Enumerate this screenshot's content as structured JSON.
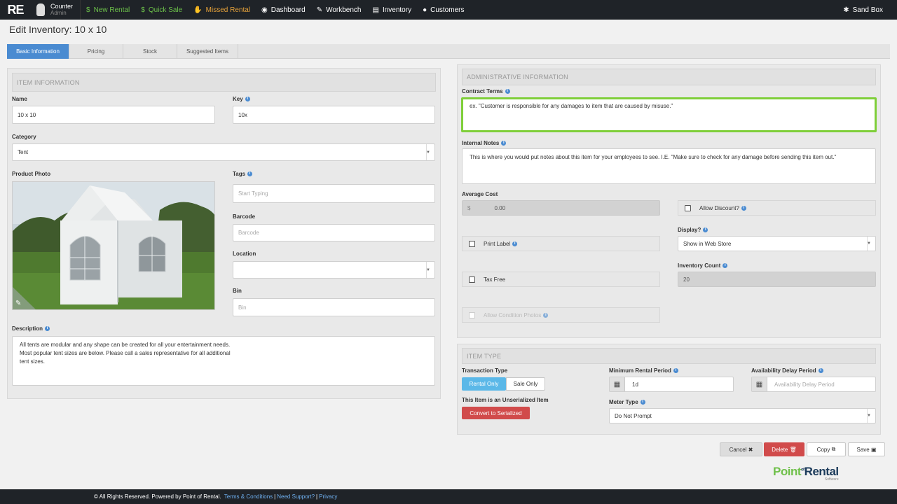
{
  "app": {
    "logo": "RE",
    "user_name": "Counter",
    "user_role": "Admin"
  },
  "nav": [
    {
      "label": "New Rental",
      "icon": "$",
      "icon_name": "dollar-icon",
      "color": "#6cc04a"
    },
    {
      "label": "Quick Sale",
      "icon": "$",
      "icon_name": "dollar-icon",
      "color": "#6cc04a"
    },
    {
      "label": "Missed Rental",
      "icon": "✋",
      "icon_name": "hand-icon",
      "color": "#e8a33a"
    },
    {
      "label": "Dashboard",
      "icon": "◉",
      "icon_name": "dashboard-icon",
      "color": "#ffffff"
    },
    {
      "label": "Workbench",
      "icon": "✎",
      "icon_name": "wrench-icon",
      "color": "#ffffff"
    },
    {
      "label": "Inventory",
      "icon": "▤",
      "icon_name": "inventory-icon",
      "color": "#ffffff"
    },
    {
      "label": "Customers",
      "icon": "●",
      "icon_name": "user-icon",
      "color": "#ffffff"
    }
  ],
  "sandbox": {
    "label": "Sand Box",
    "icon_name": "gear-icon"
  },
  "page_title": "Edit Inventory: 10 x 10",
  "tabs": [
    "Basic Information",
    "Pricing",
    "Stock",
    "Suggested Items"
  ],
  "item_info": {
    "heading": "ITEM INFORMATION",
    "name_label": "Name",
    "name_value": "10 x 10",
    "key_label": "Key",
    "key_value": "10x",
    "category_label": "Category",
    "category_value": "Tent",
    "photo_label": "Product Photo",
    "tags_label": "Tags",
    "tags_placeholder": "Start Typing",
    "barcode_label": "Barcode",
    "barcode_placeholder": "Barcode",
    "location_label": "Location",
    "location_value": "",
    "bin_label": "Bin",
    "bin_placeholder": "Bin",
    "description_label": "Description",
    "description_value": "All tents are modular and any shape can be created for all your entertainment needs.\nMost popular tent sizes are below. Please call a sales representative for all additional\ntent sizes."
  },
  "admin_info": {
    "heading": "ADMINISTRATIVE INFORMATION",
    "contract_terms_label": "Contract Terms",
    "contract_terms_value": "ex. \"Customer is responsible for any damages to item that are caused by misuse.\"",
    "internal_notes_label": "Internal Notes",
    "internal_notes_value": "This is where you would put notes about this item for your employees to see.     I.E. \"Make sure to check for any damage before sending this item out.\"",
    "average_cost_label": "Average Cost",
    "average_cost_currency": "$",
    "average_cost_value": "0.00",
    "allow_discount_label": "Allow Discount?",
    "print_label_label": "Print Label",
    "display_label": "Display?",
    "display_value": "Show in Web Store",
    "inventory_count_label": "Inventory Count",
    "inventory_count_value": "20",
    "tax_free_label": "Tax Free",
    "allow_condition_photos_label": "Allow Condition Photos"
  },
  "item_type": {
    "heading": "ITEM TYPE",
    "transaction_type_label": "Transaction Type",
    "rental_only_label": "Rental Only",
    "sale_only_label": "Sale Only",
    "unserialized_label": "This Item is an Unserialized Item",
    "convert_label": "Convert to Serialized",
    "min_rental_label": "Minimum Rental Period",
    "min_rental_value": "1d",
    "availability_delay_label": "Availability Delay Period",
    "availability_delay_placeholder": "Availability Delay Period",
    "meter_type_label": "Meter Type",
    "meter_type_value": "Do Not Prompt"
  },
  "actions": {
    "cancel": "Cancel",
    "delete": "Delete",
    "copy": "Copy",
    "save": "Save"
  },
  "footer": {
    "text": "© All Rights Reserved. Powered by Point of Rental.",
    "terms": "Terms & Conditions",
    "support": "Need Support?",
    "privacy": "Privacy",
    "sep": "|"
  },
  "brand": {
    "point": "Point",
    "of": "of",
    "rental": "Rental",
    "software": "Software"
  },
  "colors": {
    "accent": "#4a8bd1",
    "nav_green": "#6cc04a",
    "nav_orange": "#e8a33a",
    "danger": "#d14b4b",
    "highlight": "#7fcf3a"
  }
}
